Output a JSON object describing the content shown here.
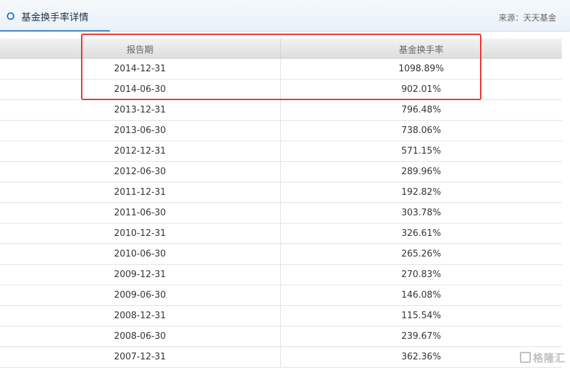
{
  "header": {
    "title": "基金换手率详情",
    "source": "来源：天天基金"
  },
  "table": {
    "columns": [
      "报告期",
      "基金换手率"
    ],
    "rows": [
      [
        "2014-12-31",
        "1098.89%"
      ],
      [
        "2014-06-30",
        "902.01%"
      ],
      [
        "2013-12-31",
        "796.48%"
      ],
      [
        "2013-06-30",
        "738.06%"
      ],
      [
        "2012-12-31",
        "571.15%"
      ],
      [
        "2012-06-30",
        "289.96%"
      ],
      [
        "2011-12-31",
        "192.82%"
      ],
      [
        "2011-06-30",
        "303.78%"
      ],
      [
        "2010-12-31",
        "326.61%"
      ],
      [
        "2010-06-30",
        "265.26%"
      ],
      [
        "2009-12-31",
        "270.83%"
      ],
      [
        "2009-06-30",
        "146.08%"
      ],
      [
        "2008-12-31",
        "115.54%"
      ],
      [
        "2008-06-30",
        "239.67%"
      ],
      [
        "2007-12-31",
        "362.36%"
      ]
    ]
  },
  "watermark": "格隆汇",
  "colors": {
    "accent": "#2f78c2",
    "highlight": "#e8342f"
  }
}
